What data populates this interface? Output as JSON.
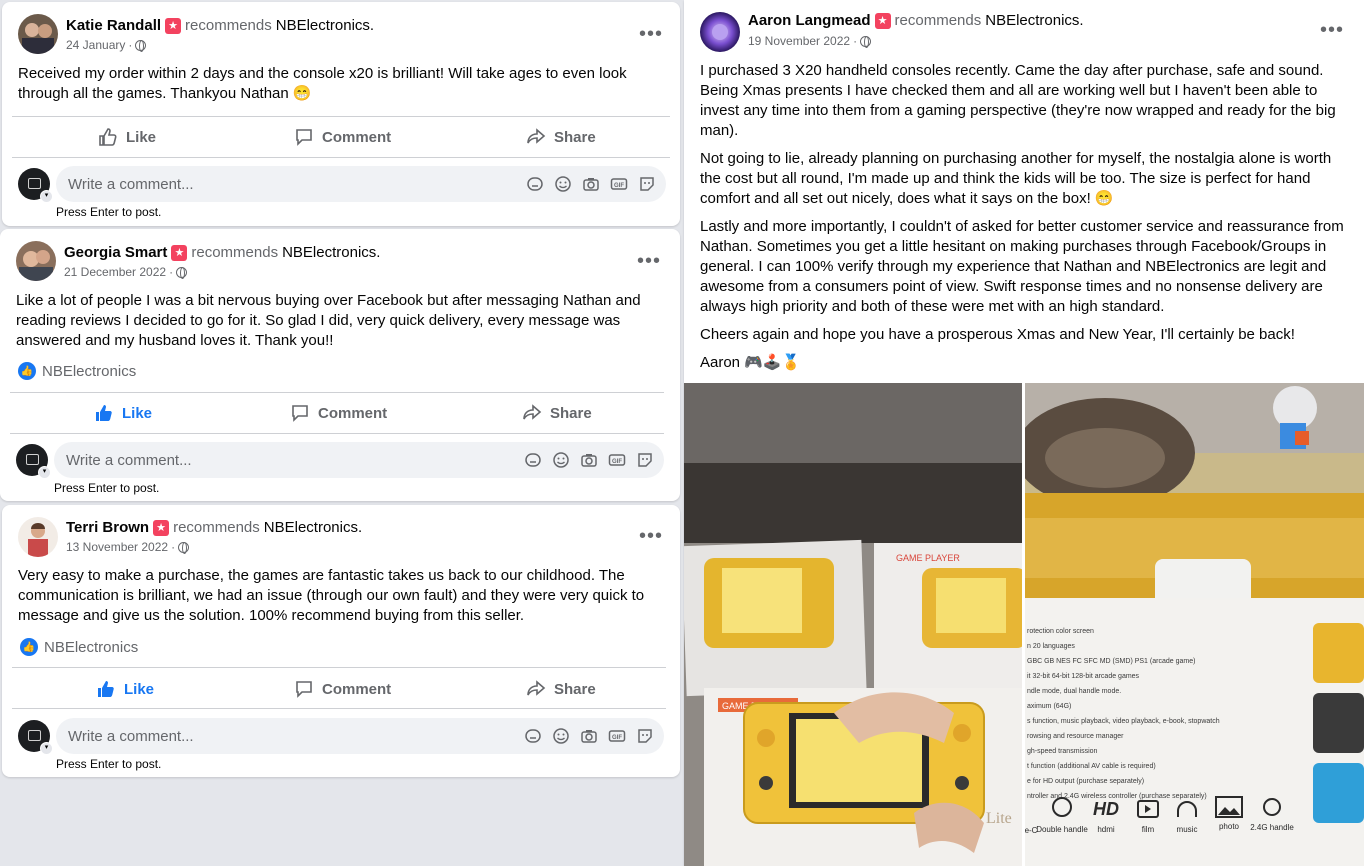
{
  "common": {
    "recommends": "recommends",
    "page": "NBElectronics.",
    "like": "Like",
    "comment": "Comment",
    "share": "Share",
    "write_placeholder": "Write a comment...",
    "press_enter": "Press Enter to post.",
    "page_reaction": "NBElectronics",
    "more": "•••"
  },
  "posts": [
    {
      "name": "Katie Randall",
      "date": "24 January",
      "text": "Received my order within 2 days and the console x20 is brilliant! Will take ages to even look through all the games. Thankyou Nathan 😁",
      "liked": false
    },
    {
      "name": "Georgia Smart",
      "date": "21 December 2022",
      "text": "Like a lot of people I was a bit nervous buying over Facebook but after messaging Nathan and reading reviews I decided to go for it. So glad I did, very quick delivery, every message was answered and my husband loves it. Thank you!!",
      "liked": true
    },
    {
      "name": "Terri Brown",
      "date": "13 November 2022",
      "text": "Very easy to make a purchase, the games are fantastic takes us back to our childhood. The communication is brilliant, we had an issue (through our own fault) and they were very quick to message and give us the solution. 100% recommend buying from this seller.",
      "liked": true
    },
    {
      "name": "Aaron Langmead",
      "date": "19 November 2022",
      "paragraphs": [
        "I purchased 3 X20 handheld consoles recently. Came the day after purchase, safe and sound. Being Xmas presents I have checked them and all are working well but I haven't been able to invest any time into them from a gaming perspective (they're now wrapped and ready for the big man).",
        "Not going to lie, already planning on purchasing another for myself, the nostalgia alone is worth the cost but all round, I'm made up and think the kids will be too. The size is perfect for hand comfort and all set out nicely, does what it says on the box! 😁",
        "Lastly and more importantly, I couldn't of asked for better customer service and reassurance from Nathan. Sometimes you get a little hesitant on making purchases through Facebook/Groups in general. I can 100% verify through my experience that Nathan and NBElectronics are legit and awesome from a consumers point of view. Swift response times and no nonsense delivery are always high priority and both of these were met with an high standard.",
        "Cheers again and hope you have a prosperous Xmas and New Year, I'll certainly be back!",
        "Aaron 🎮🕹️🏅"
      ]
    }
  ],
  "photo_left": {
    "box_label_1": "GAME PLAYER",
    "box_label_2": "GAME PLAYER",
    "box_brand": "Lite"
  },
  "photo_right": {
    "spec_lines": [
      "rotection color screen",
      "n 20 languages",
      "GBC GB NES FC SFC MD (SMD) PS1 (arcade game)",
      "it 32-bit 64-bit 128-bit arcade games",
      "ndle mode, dual handle mode.",
      "aximum (64G)",
      "s function, music playback, video playback, e-book, stopwatch",
      "rowsing and resource manager",
      "gh-speed transmission",
      "t function (additional AV cable is required)",
      "e for HD output (purchase separately)",
      "ntroller and 2.4G wireless controller (purchase separately)"
    ],
    "features": [
      "e-C",
      "Double handle",
      "hdmi",
      "film",
      "music",
      "photo",
      "2.4G handle"
    ],
    "hd_label": "HD"
  },
  "colors": {
    "like_blue": "#1877f2",
    "recommend_red": "#f3425f",
    "muted": "#65676b"
  }
}
